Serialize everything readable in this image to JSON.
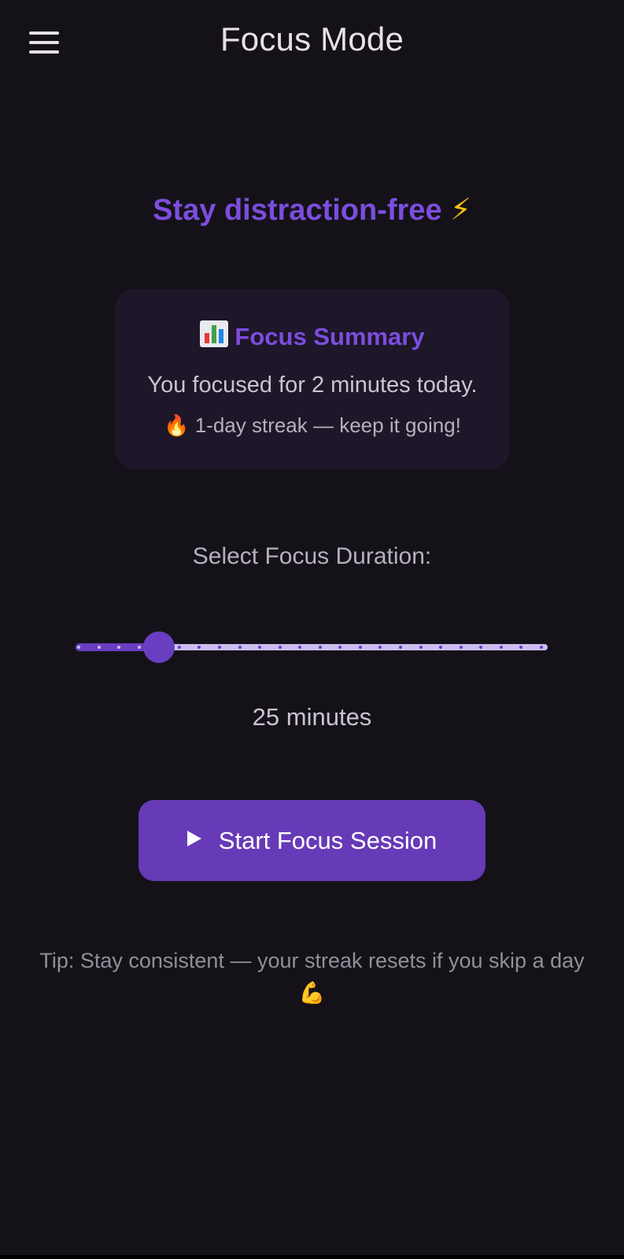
{
  "appbar": {
    "title": "Focus Mode",
    "menu_icon": "menu-icon"
  },
  "headline": {
    "text": "Stay distraction-free",
    "emoji": "⚡"
  },
  "summary": {
    "icon": "bar-chart-icon",
    "title": "Focus Summary",
    "line1": "You focused for 2 minutes today.",
    "line2": "🔥 1-day streak — keep it going!"
  },
  "duration": {
    "label": "Select Focus Duration:",
    "value_text": "25 minutes",
    "slider": {
      "value": 25,
      "min": 5,
      "max": 120,
      "step": 5
    }
  },
  "start_button": {
    "icon": "play-icon",
    "label": "Start Focus Session"
  },
  "tip": {
    "text": "Tip: Stay consistent — your streak resets if you skip a day 💪"
  },
  "colors": {
    "background": "#141218",
    "accent": "#7c4dde",
    "button": "#673ab7",
    "card": "#1e1629",
    "track_inactive": "#cbbdf0",
    "track_active": "#6a3ec0"
  }
}
